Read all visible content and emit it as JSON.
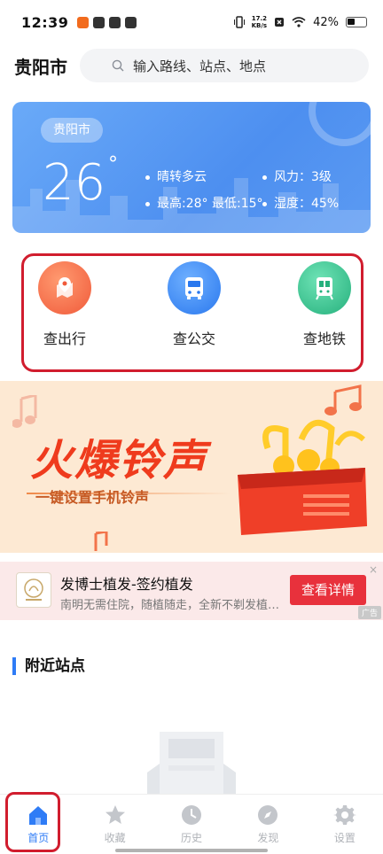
{
  "status_bar": {
    "time": "12:39",
    "net_speed_value": "17.2",
    "net_speed_unit": "KB/s",
    "battery": "42%"
  },
  "header": {
    "city": "贵阳市",
    "search_placeholder": "输入路线、站点、地点"
  },
  "weather": {
    "city": "贵阳市",
    "temperature": "26",
    "degree_symbol": "°",
    "condition": "晴转多云",
    "high_low": "最高:28°  最低:15°",
    "wind": "风力：3级",
    "humidity": "湿度：45%"
  },
  "quick_actions": [
    {
      "label": "查出行",
      "icon": "map-pin-icon",
      "color": "#f26a4b"
    },
    {
      "label": "查公交",
      "icon": "bus-icon",
      "color": "#3a86f0"
    },
    {
      "label": "查地铁",
      "icon": "metro-icon",
      "color": "#2fbf8a"
    }
  ],
  "banner": {
    "title": "火爆铃声",
    "subtitle": "一键设置手机铃声"
  },
  "ad": {
    "title": "发博士植发-签约植发",
    "description": "南明无需住院，随植随走，全新不剃发植…",
    "button": "查看详情",
    "tag": "广告",
    "close": "×"
  },
  "nearby": {
    "title": "附近站点"
  },
  "bottom_nav": [
    {
      "label": "首页",
      "icon": "home-icon",
      "active": true
    },
    {
      "label": "收藏",
      "icon": "star-icon",
      "active": false
    },
    {
      "label": "历史",
      "icon": "clock-icon",
      "active": false
    },
    {
      "label": "发现",
      "icon": "compass-icon",
      "active": false
    },
    {
      "label": "设置",
      "icon": "gear-icon",
      "active": false
    }
  ],
  "colors": {
    "accent": "#2f7cf6",
    "highlight_border": "#d11d2e",
    "ad_button": "#e8313c",
    "banner_title": "#ef3b1d"
  }
}
